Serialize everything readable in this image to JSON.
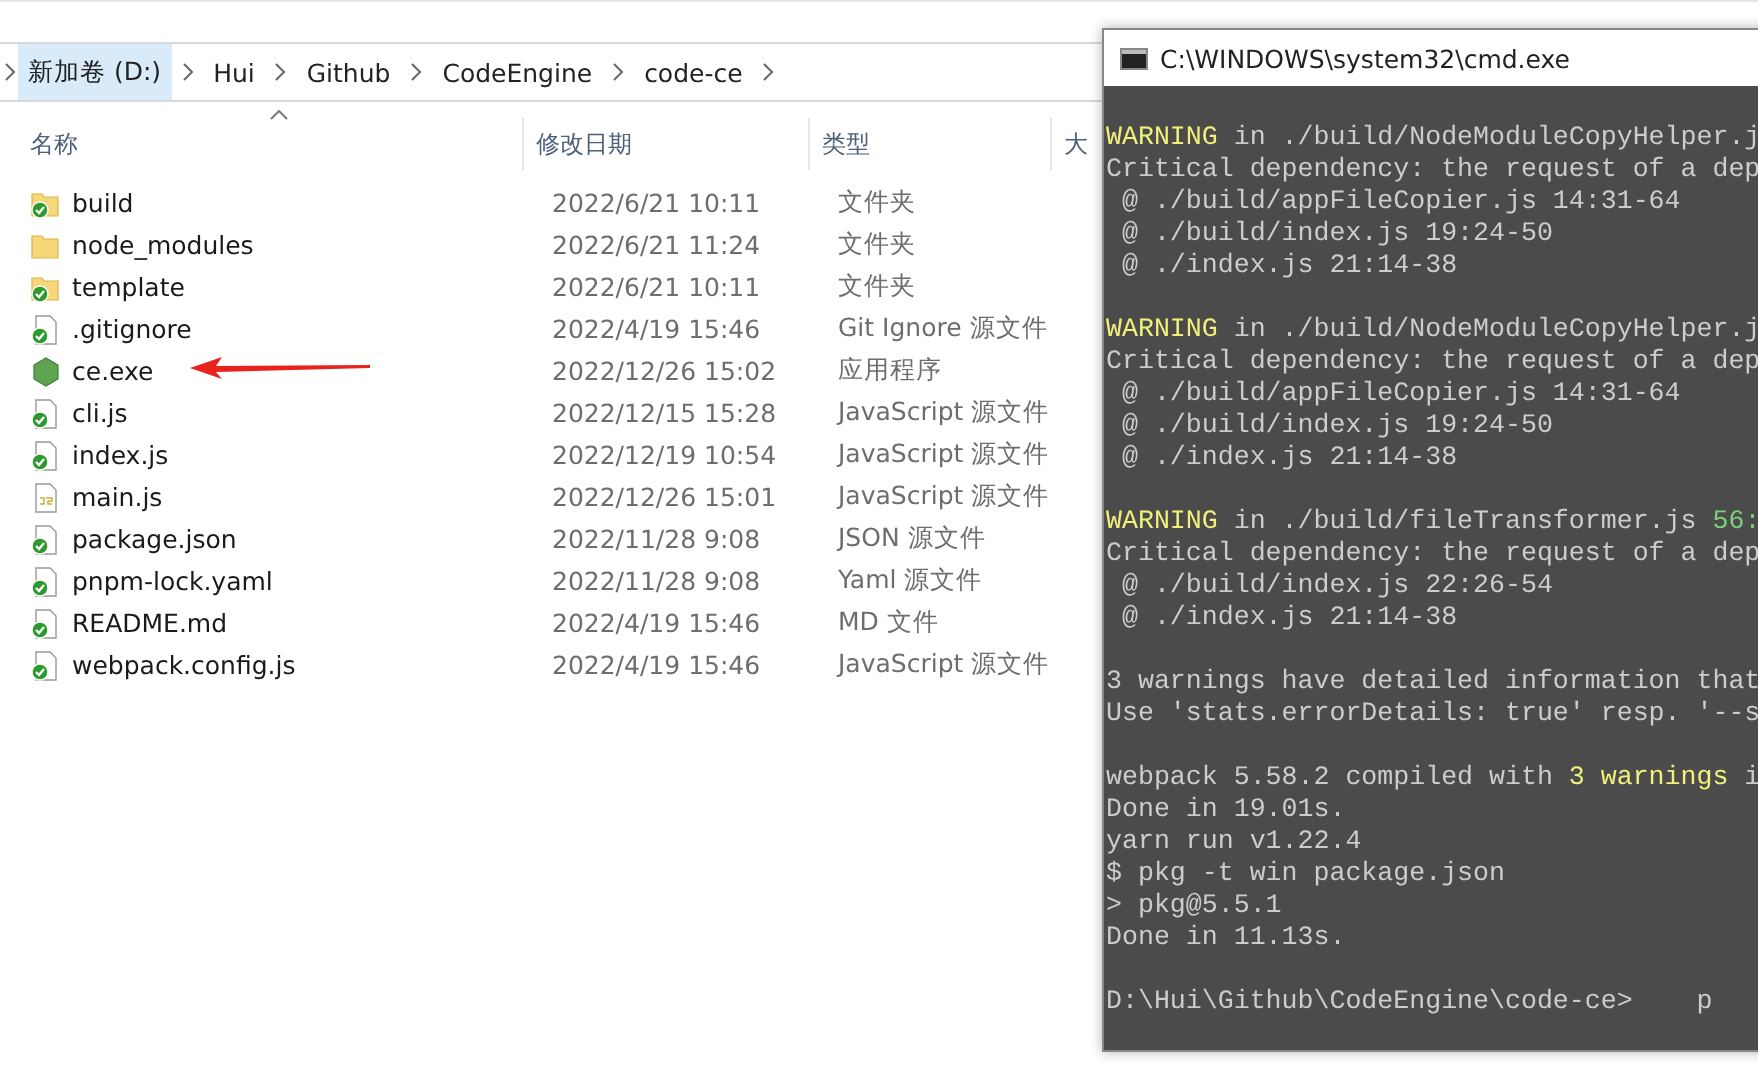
{
  "breadcrumb": [
    {
      "label": "新加卷 (D:)",
      "selected": true
    },
    {
      "label": "Hui",
      "selected": false
    },
    {
      "label": "Github",
      "selected": false
    },
    {
      "label": "CodeEngine",
      "selected": false
    },
    {
      "label": "code-ce",
      "selected": false
    }
  ],
  "columns": [
    "名称",
    "修改日期",
    "类型",
    "大"
  ],
  "files": [
    {
      "name": "build",
      "date": "2022/6/21 10:11",
      "type": "文件夹",
      "kind": "folder",
      "synced": true
    },
    {
      "name": "node_modules",
      "date": "2022/6/21 11:24",
      "type": "文件夹",
      "kind": "folder",
      "synced": false
    },
    {
      "name": "template",
      "date": "2022/6/21 10:11",
      "type": "文件夹",
      "kind": "folder",
      "synced": true
    },
    {
      "name": ".gitignore",
      "date": "2022/4/19 15:46",
      "type": "Git Ignore 源文件",
      "kind": "file",
      "synced": true
    },
    {
      "name": "ce.exe",
      "date": "2022/12/26 15:02",
      "type": "应用程序",
      "kind": "exe",
      "synced": false
    },
    {
      "name": "cli.js",
      "date": "2022/12/15 15:28",
      "type": "JavaScript 源文件",
      "kind": "file",
      "synced": true
    },
    {
      "name": "index.js",
      "date": "2022/12/19 10:54",
      "type": "JavaScript 源文件",
      "kind": "file",
      "synced": true
    },
    {
      "name": "main.js",
      "date": "2022/12/26 15:01",
      "type": "JavaScript 源文件",
      "kind": "js",
      "synced": false
    },
    {
      "name": "package.json",
      "date": "2022/11/28 9:08",
      "type": "JSON 源文件",
      "kind": "file",
      "synced": true
    },
    {
      "name": "pnpm-lock.yaml",
      "date": "2022/11/28 9:08",
      "type": "Yaml 源文件",
      "kind": "file",
      "synced": true
    },
    {
      "name": "README.md",
      "date": "2022/4/19 15:46",
      "type": "MD 文件",
      "kind": "file",
      "synced": true
    },
    {
      "name": "webpack.config.js",
      "date": "2022/4/19 15:46",
      "type": "JavaScript 源文件",
      "kind": "file",
      "synced": true
    }
  ],
  "terminal": {
    "title": "C:\\WINDOWS\\system32\\cmd.exe",
    "blocks": [
      {
        "lines": [
          [
            {
              "text": "WARNING",
              "color": "#f0f07a"
            },
            {
              "text": " in ./build/NodeModuleCopyHelper.j",
              "color": "#cccccc"
            }
          ],
          [
            {
              "text": "Critical dependency: the request of a dep",
              "color": "#cccccc"
            }
          ],
          [
            {
              "text": " @ ./build/appFileCopier.js 14:31-64",
              "color": "#cccccc"
            }
          ],
          [
            {
              "text": " @ ./build/index.js 19:24-50",
              "color": "#cccccc"
            }
          ],
          [
            {
              "text": " @ ./index.js 21:14-38",
              "color": "#cccccc"
            }
          ]
        ]
      },
      {
        "lines": [
          [
            {
              "text": "WARNING",
              "color": "#f0f07a"
            },
            {
              "text": " in ./build/NodeModuleCopyHelper.j",
              "color": "#cccccc"
            }
          ],
          [
            {
              "text": "Critical dependency: the request of a dep",
              "color": "#cccccc"
            }
          ],
          [
            {
              "text": " @ ./build/appFileCopier.js 14:31-64",
              "color": "#cccccc"
            }
          ],
          [
            {
              "text": " @ ./build/index.js 19:24-50",
              "color": "#cccccc"
            }
          ],
          [
            {
              "text": " @ ./index.js 21:14-38",
              "color": "#cccccc"
            }
          ]
        ]
      },
      {
        "lines": [
          [
            {
              "text": "WARNING",
              "color": "#f0f07a"
            },
            {
              "text": " in ./build/fileTransformer.js ",
              "color": "#cccccc"
            },
            {
              "text": "56:",
              "color": "#7ad07a"
            }
          ],
          [
            {
              "text": "Critical dependency: the request of a dep",
              "color": "#cccccc"
            }
          ],
          [
            {
              "text": " @ ./build/index.js 22:26-54",
              "color": "#cccccc"
            }
          ],
          [
            {
              "text": " @ ./index.js 21:14-38",
              "color": "#cccccc"
            }
          ]
        ]
      },
      {
        "lines": [
          [
            {
              "text": "3 warnings have detailed information that",
              "color": "#cccccc"
            }
          ],
          [
            {
              "text": "Use 'stats.errorDetails: true' resp. '--s",
              "color": "#cccccc"
            }
          ]
        ]
      },
      {
        "lines": [
          [
            {
              "text": "webpack 5.58.2 compiled with ",
              "color": "#cccccc"
            },
            {
              "text": "3 warnings",
              "color": "#f0f07a"
            },
            {
              "text": " i",
              "color": "#cccccc"
            }
          ],
          [
            {
              "text": "Done in 19.01s.",
              "color": "#cccccc"
            }
          ],
          [
            {
              "text": "yarn run v1.22.4",
              "color": "#cccccc"
            }
          ],
          [
            {
              "text": "$ pkg -t win package.json",
              "color": "#cccccc"
            }
          ],
          [
            {
              "text": "> pkg@5.5.1",
              "color": "#cccccc"
            }
          ],
          [
            {
              "text": "Done in 11.13s.",
              "color": "#cccccc"
            }
          ]
        ]
      },
      {
        "lines": [
          [
            {
              "text": "D:\\Hui\\Github\\CodeEngine\\code-ce>    p",
              "color": "#cccccc"
            }
          ]
        ]
      }
    ]
  }
}
